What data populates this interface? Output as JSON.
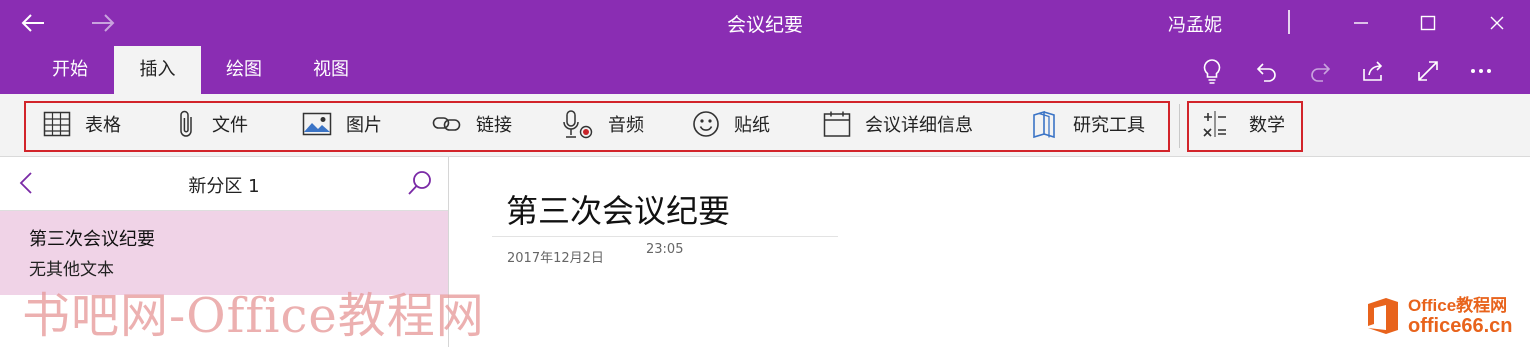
{
  "window": {
    "title": "会议纪要",
    "user": "冯孟妮",
    "icons": [
      "back-arrow-icon",
      "forward-arrow-icon",
      "minimize-icon",
      "maximize-icon",
      "close-icon"
    ]
  },
  "tabs": [
    {
      "label": "开始"
    },
    {
      "label": "插入",
      "active": true
    },
    {
      "label": "绘图"
    },
    {
      "label": "视图"
    }
  ],
  "quick_actions": [
    "lightbulb-icon",
    "undo-icon",
    "redo-icon",
    "share-icon",
    "fullscreen-icon",
    "more-icon"
  ],
  "ribbon": {
    "items": [
      {
        "label": "表格",
        "icon": "table-icon"
      },
      {
        "label": "文件",
        "icon": "paperclip-icon"
      },
      {
        "label": "图片",
        "icon": "picture-icon"
      },
      {
        "label": "链接",
        "icon": "link-icon"
      },
      {
        "label": "音频",
        "icon": "microphone-icon"
      },
      {
        "label": "贴纸",
        "icon": "sticker-icon"
      },
      {
        "label": "会议详细信息",
        "icon": "calendar-icon"
      },
      {
        "label": "研究工具",
        "icon": "research-icon"
      }
    ],
    "math": {
      "label": "数学",
      "icon": "math-icon"
    },
    "highlight_color": "#d2242a"
  },
  "section": {
    "title": "新分区 1",
    "pages": [
      {
        "title": "第三次会议纪要",
        "preview": "无其他文本"
      }
    ]
  },
  "page": {
    "title": "第三次会议纪要",
    "date": "2017年12月2日",
    "time": "23:05"
  },
  "watermarks": {
    "left": "书吧网-Office教程网",
    "logo_line1": "Office教程网",
    "logo_line2": "office66.cn"
  },
  "colors": {
    "brand": "#8a2db3",
    "ribbon_bg": "#f3f3f3",
    "selected_page": "#f0d3e7"
  }
}
